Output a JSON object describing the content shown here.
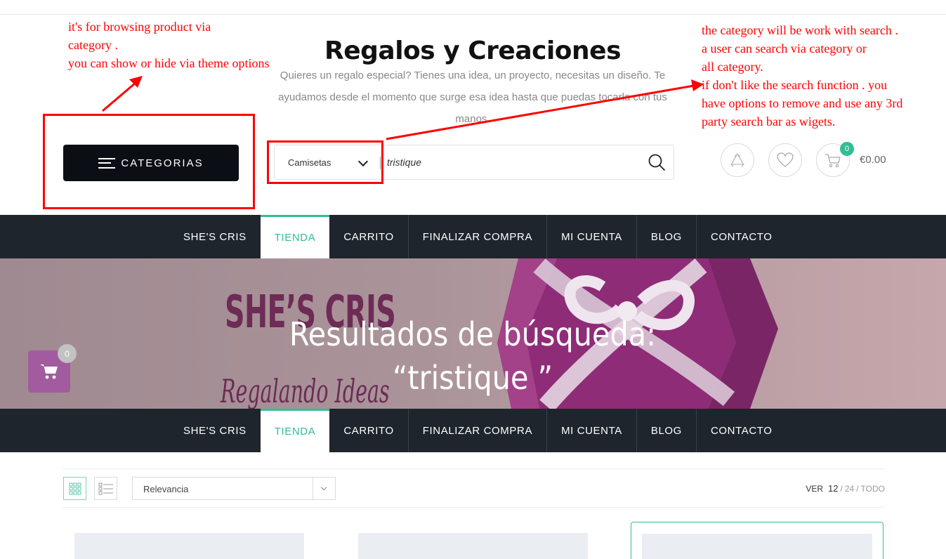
{
  "annotations": {
    "left": [
      "it's for browsing product via",
      "category .",
      "you can show or hide via theme options"
    ],
    "right": [
      "the category will be work with search .",
      "a user can search via category or",
      "all category.",
      "if don't like the search function . you",
      "have options to remove and use any 3rd",
      "party search bar as wigets."
    ],
    "color": "#ff0000"
  },
  "header": {
    "site_title": "Regalos y Creaciones",
    "tagline": "Quieres un regalo especial? Tienes una idea, un proyecto, necesitas un diseño. Te ayudamos desde el momento que surge esa idea hasta que puedas tocarla con tus manos.",
    "categories_label": "CATEGORIAS",
    "search": {
      "category_selected": "Camisetas",
      "query": "tristique",
      "icon": "search-icon"
    },
    "cart": {
      "count": "0",
      "total": "€0.00"
    }
  },
  "nav": {
    "items": [
      "SHE'S CRIS",
      "TIENDA",
      "CARRITO",
      "FINALIZAR COMPRA",
      "MI CUENTA",
      "BLOG",
      "CONTACTO"
    ],
    "active": "TIENDA",
    "active_color": "#33bd96",
    "background": "#1e252c"
  },
  "hero": {
    "title_line1": "Resultados de búsqueda:",
    "title_line2": "“tristique ”",
    "brand": "SHE’S CRIS",
    "brand_sub": "Regalando Ideas",
    "floating_cart_count": "0"
  },
  "shop": {
    "sort_selected": "Relevancia",
    "per_page_label": "VER",
    "per_page_options": [
      "12",
      "24",
      "TODO"
    ],
    "per_page_current": "12"
  }
}
